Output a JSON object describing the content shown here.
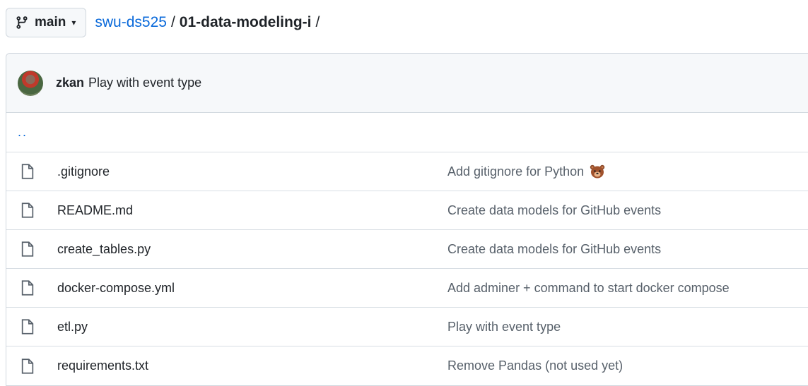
{
  "branch": {
    "label": "main"
  },
  "breadcrumb": {
    "repo": "swu-ds525",
    "sep1": "/",
    "dir": "01-data-modeling-i",
    "sep2": "/"
  },
  "latest_commit": {
    "author": "zkan",
    "message": "Play with event type"
  },
  "parent_dir": {
    "label": ".."
  },
  "files": [
    {
      "name": ".gitignore",
      "commit": "Add gitignore for Python",
      "emoji": "bear-icon"
    },
    {
      "name": "README.md",
      "commit": "Create data models for GitHub events"
    },
    {
      "name": "create_tables.py",
      "commit": "Create data models for GitHub events"
    },
    {
      "name": "docker-compose.yml",
      "commit": "Add adminer + command to start docker compose"
    },
    {
      "name": "etl.py",
      "commit": "Play with event type"
    },
    {
      "name": "requirements.txt",
      "commit": "Remove Pandas (not used yet)"
    }
  ],
  "icons": {
    "branch": "git-branch-icon",
    "file": "file-icon",
    "caret": "triangle-down-icon"
  },
  "colors": {
    "link": "#0969da",
    "muted": "#57606a",
    "header_bg": "#f6f8fa",
    "border": "#d0d7de"
  }
}
